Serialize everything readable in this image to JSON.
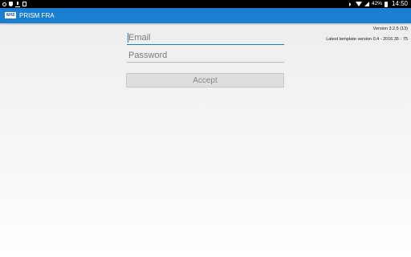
{
  "status_bar": {
    "battery_percent": "42%",
    "time": "14:50"
  },
  "app_bar": {
    "logo_text": "NHS",
    "title": "PRISM FRA"
  },
  "info": {
    "version": "Version 3.2.5 (13)",
    "template_version": "Latest template version 0.4 - 2016.35 - 75"
  },
  "form": {
    "email_placeholder": "Email",
    "email_value": "",
    "password_placeholder": "Password",
    "password_value": "",
    "accept_label": "Accept"
  },
  "colors": {
    "app_bar": "#1a7fd0",
    "status_bar": "#000000",
    "button_bg": "#dedede"
  }
}
